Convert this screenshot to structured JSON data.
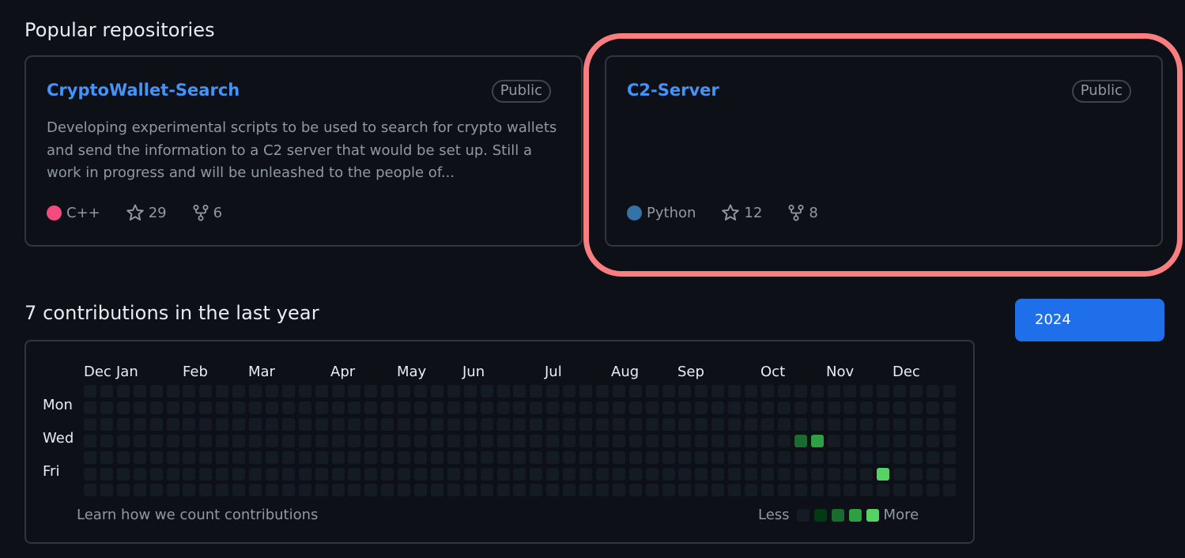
{
  "popular": {
    "title": "Popular repositories",
    "repos": [
      {
        "name": "CryptoWallet-Search",
        "visibility": "Public",
        "description": "Developing experimental scripts to be used to search for crypto wallets and send the information to a C2 server that would be set up. Still a work in progress and will be unleashed to the people of...",
        "language": "C++",
        "language_color": "#f34b7d",
        "stars": "29",
        "forks": "6"
      },
      {
        "name": "C2-Server",
        "visibility": "Public",
        "description": "",
        "language": "Python",
        "language_color": "#3572a5",
        "stars": "12",
        "forks": "8"
      }
    ]
  },
  "contributions": {
    "title": "7 contributions in the last year",
    "months": [
      "Dec",
      "Jan",
      "Feb",
      "Mar",
      "Apr",
      "May",
      "Jun",
      "Jul",
      "Aug",
      "Sep",
      "Oct",
      "Nov",
      "Dec"
    ],
    "days": [
      "Mon",
      "Wed",
      "Fri"
    ],
    "learn_link": "Learn how we count contributions",
    "legend_less": "Less",
    "legend_more": "More",
    "legend_colors": [
      "#151b23",
      "#033a16",
      "#196c2e",
      "#2ea043",
      "#56d364"
    ],
    "level_colors": [
      "#151b23",
      "#033a16",
      "#196c2e",
      "#2ea043",
      "#56d364"
    ],
    "active_cells": [
      {
        "week": 43,
        "day": 3,
        "level": 2
      },
      {
        "week": 44,
        "day": 3,
        "level": 3
      },
      {
        "week": 48,
        "day": 5,
        "level": 4
      }
    ]
  },
  "year_selector": {
    "selected": "2024"
  },
  "annotation": {
    "highlight_color": "#f87e80"
  }
}
